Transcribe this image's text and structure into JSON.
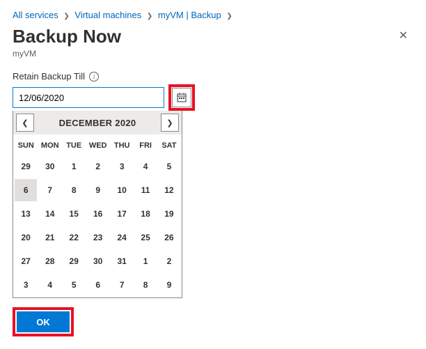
{
  "breadcrumb": {
    "items": [
      {
        "label": "All services"
      },
      {
        "label": "Virtual machines"
      },
      {
        "label": "myVM | Backup"
      }
    ]
  },
  "page": {
    "title": "Backup Now",
    "subtitle": "myVM"
  },
  "field": {
    "retain_label": "Retain Backup Till",
    "date_value": "12/06/2020"
  },
  "calendar": {
    "month_label": "DECEMBER 2020",
    "dow": [
      "SUN",
      "MON",
      "TUE",
      "WED",
      "THU",
      "FRI",
      "SAT"
    ],
    "weeks": [
      [
        "29",
        "30",
        "1",
        "2",
        "3",
        "4",
        "5"
      ],
      [
        "6",
        "7",
        "8",
        "9",
        "10",
        "11",
        "12"
      ],
      [
        "13",
        "14",
        "15",
        "16",
        "17",
        "18",
        "19"
      ],
      [
        "20",
        "21",
        "22",
        "23",
        "24",
        "25",
        "26"
      ],
      [
        "27",
        "28",
        "29",
        "30",
        "31",
        "1",
        "2"
      ],
      [
        "3",
        "4",
        "5",
        "6",
        "7",
        "8",
        "9"
      ]
    ],
    "selected": [
      1,
      0
    ]
  },
  "actions": {
    "ok_label": "OK"
  }
}
